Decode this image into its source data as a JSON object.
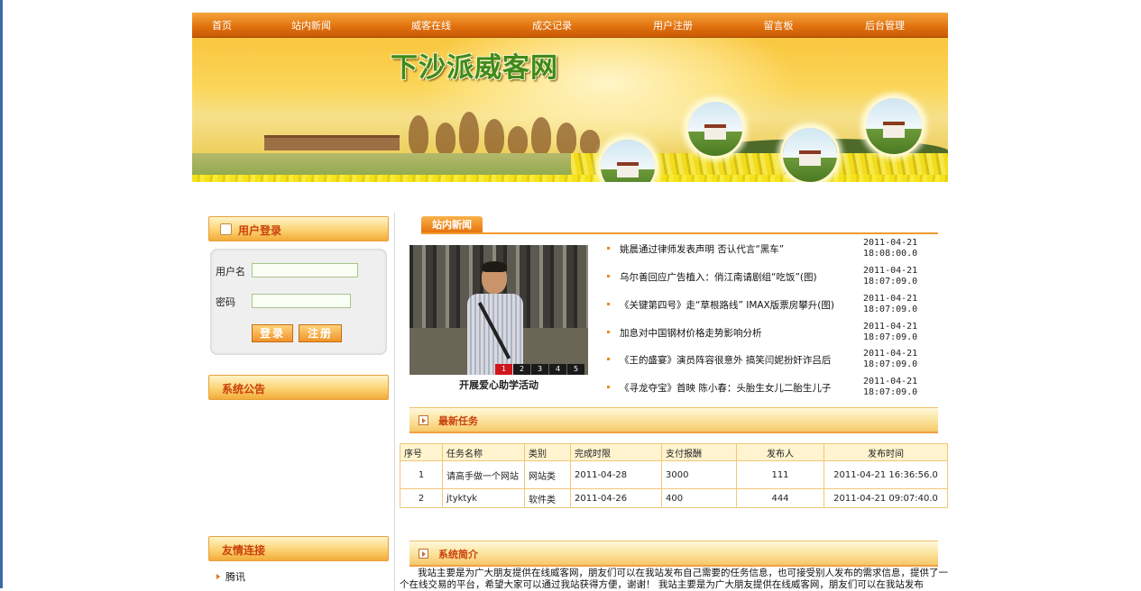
{
  "nav": [
    "首页",
    "站内新闻",
    "威客在线",
    "成交记录",
    "用户注册",
    "留言板",
    "后台管理"
  ],
  "banner": {
    "site_title": "下沙派威客网"
  },
  "login": {
    "title": "用户登录",
    "username_label": "用户名",
    "password_label": "密码",
    "login_button": "登录",
    "register_button": "注册"
  },
  "notice": {
    "title": "系统公告"
  },
  "links": {
    "title": "友情连接",
    "items": [
      "腾讯"
    ]
  },
  "news": {
    "tab": "站内新闻",
    "photo_caption": "开展爱心助学活动",
    "pager": [
      "1",
      "2",
      "3",
      "4",
      "5"
    ],
    "items": [
      {
        "title": "姚晨通过律师发表声明 否认代言“黑车”",
        "date": "2011-04-21\n18:08:00.0"
      },
      {
        "title": "乌尔善回应广告植入：俏江南请剧组“吃饭”(图)",
        "date": "2011-04-21\n18:07:09.0"
      },
      {
        "title": "《关键第四号》走“草根路线” IMAX版票房攀升(图)",
        "date": "2011-04-21\n18:07:09.0"
      },
      {
        "title": "加息对中国钢材价格走势影响分析",
        "date": "2011-04-21\n18:07:09.0"
      },
      {
        "title": "《王的盛宴》演员阵容很意外 搞笑闫妮扮奸诈吕后",
        "date": "2011-04-21\n18:07:09.0"
      },
      {
        "title": "《寻龙夺宝》首映 陈小春：头胎生女儿二胎生儿子",
        "date": "2011-04-21\n18:07:09.0"
      }
    ]
  },
  "tasks": {
    "title": "最新任务",
    "headers": [
      "序号",
      "任务名称",
      "类别",
      "完成时限",
      "支付报酬",
      "发布人",
      "发布时间"
    ],
    "rows": [
      [
        "1",
        "请高手做一个网站",
        "网站类",
        "2011-04-28",
        "3000",
        "111",
        "2011-04-21 16:36:56.0"
      ],
      [
        "2",
        "jtyktyk",
        "软件类",
        "2011-04-26",
        "400",
        "444",
        "2011-04-21 09:07:40.0"
      ]
    ]
  },
  "intro": {
    "title": "系统简介",
    "text": "我站主要是为广大朋友提供在线威客网，朋友们可以在我站发布自己需要的任务信息，也可接受别人发布的需求信息，提供了一个在线交易的平台，希望大家可以通过我站获得方便，谢谢！     我站主要是为广大朋友提供在线威客网，朋友们可以在我站发布"
  },
  "colors": {
    "nav_orange": "#e06f0c",
    "title_red": "#c9400a",
    "border_orange": "#f39a2c"
  }
}
